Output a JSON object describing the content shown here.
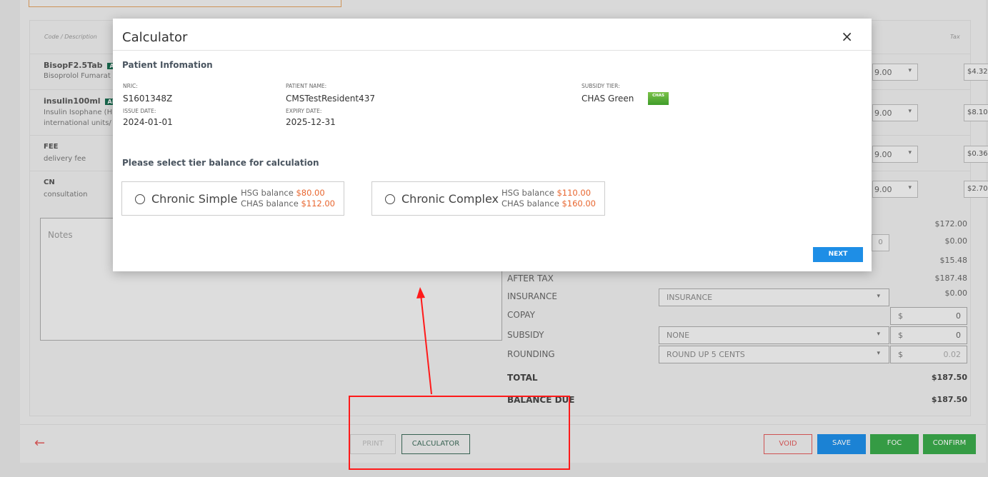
{
  "table": {
    "headers": {
      "code": "Code / Description",
      "tax": "Tax"
    },
    "rows": [
      {
        "code": "BisopF2.5Tab",
        "badge": "AL",
        "desc1": "Bisoprolol Fumarat",
        "desc2": "",
        "select": "9.00",
        "tax": "$4.32"
      },
      {
        "code": "insulin100ml",
        "badge": "AL",
        "desc1": "Insulin Isophane (H",
        "desc2": "international units/",
        "select": "9.00",
        "tax": "$8.10"
      },
      {
        "code": "FEE",
        "badge": "",
        "desc1": "delivery fee",
        "desc2": "",
        "select": "9.00",
        "tax": "$0.36"
      },
      {
        "code": "CN",
        "badge": "",
        "desc1": "consultation",
        "desc2": "",
        "select": "9.00",
        "tax": "$2.70"
      }
    ]
  },
  "notes": {
    "placeholder": "Notes"
  },
  "summary": {
    "values_top": [
      "$172.00",
      "$0.00",
      "$15.48"
    ],
    "discount_input": "0",
    "after_tax": {
      "label": "AFTER TAX",
      "value": "$187.48"
    },
    "insurance": {
      "label": "INSURANCE",
      "dropdown": "INSURANCE",
      "value": "$0.00"
    },
    "copay": {
      "label": "COPAY",
      "currency": "$",
      "value": "0"
    },
    "subsidy": {
      "label": "SUBSIDY",
      "dropdown": "NONE",
      "currency": "$",
      "value": "0"
    },
    "rounding": {
      "label": "ROUNDING",
      "dropdown": "ROUND UP 5 CENTS",
      "currency": "$",
      "value": "0.02"
    },
    "total": {
      "label": "TOTAL",
      "value": "$187.50"
    },
    "balance_due": {
      "label": "BALANCE DUE",
      "value": "$187.50"
    }
  },
  "footer": {
    "back_icon": "arrow-left-icon",
    "print": "PRINT",
    "calculator": "CALCULATOR",
    "void": "VOID",
    "save": "SAVE",
    "foc": "FOC",
    "confirm": "CONFIRM"
  },
  "modal": {
    "title": "Calculator",
    "close": "×",
    "patient_section": "Patient Infomation",
    "nric_label": "NRIC:",
    "nric": "S1601348Z",
    "patient_name_label": "PATIENT NAME:",
    "patient_name": "CMSTestResident437",
    "subsidy_tier_label": "SUBSIDY TIER:",
    "subsidy_tier": "CHAS Green",
    "chas_logo": "CHAS",
    "issue_date_label": "ISSUE DATE:",
    "issue_date": "2024-01-01",
    "expiry_date_label": "EXPIRY DATE:",
    "expiry_date": "2025-12-31",
    "tier_prompt": "Please select tier balance for calculation",
    "tiers": [
      {
        "name": "Chronic Simple",
        "hsg_label": "HSG balance",
        "hsg": "$80.00",
        "chas_label": "CHAS balance",
        "chas": "$112.00"
      },
      {
        "name": "Chronic Complex",
        "hsg_label": "HSG balance",
        "hsg": "$110.00",
        "chas_label": "CHAS balance",
        "chas": "$160.00"
      }
    ],
    "next": "NEXT"
  },
  "colors": {
    "accent": "#1e8ee6",
    "orange": "#e8662f",
    "void": "#e05a5a",
    "foc": "#3aa94a",
    "annotation": "#ff1a1a"
  }
}
